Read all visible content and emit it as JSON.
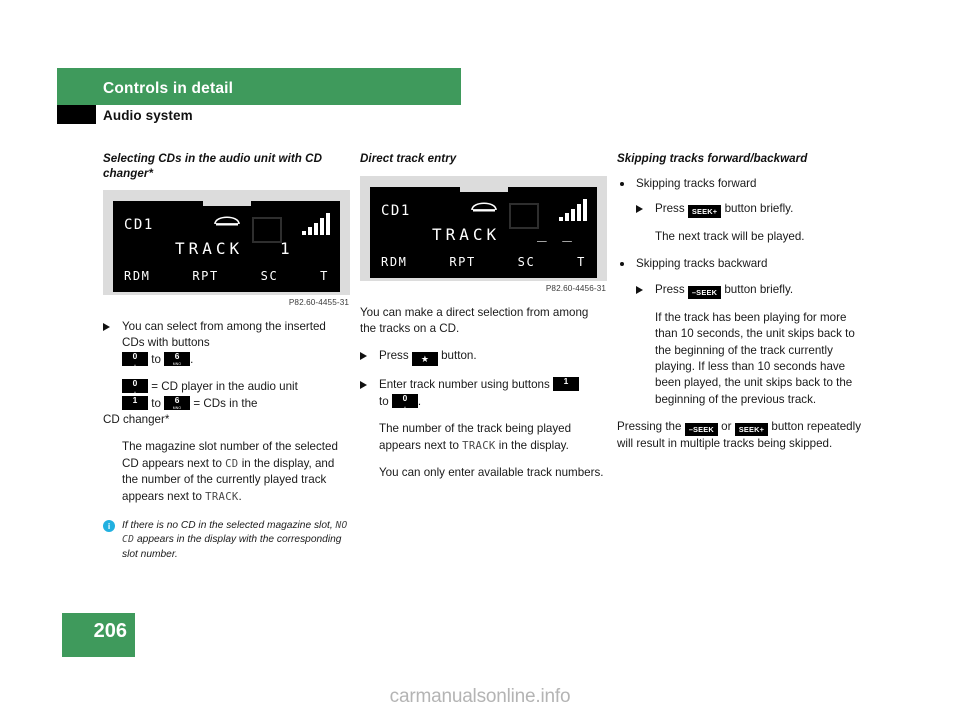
{
  "header": {
    "chapter_title": "Controls in detail",
    "section_title": "Audio system"
  },
  "footer": {
    "page_number": "206",
    "watermark": "carmanualsonline.info"
  },
  "colors": {
    "green": "#3f9a5c",
    "info_blue": "#21b0e0",
    "keycap_black": "#000000",
    "figure_bg": "#dcdcdc"
  },
  "column1": {
    "title": "Selecting CDs in the audio unit with CD changer*",
    "figure": {
      "caption": "P82.60-4455-31",
      "display": {
        "cd_label": "CD1",
        "track_label": "TRACK",
        "track_value": "1",
        "status_rdm": "RDM",
        "status_rpt": "RPT",
        "status_sc": "SC",
        "status_t": "T",
        "phone_icon": "handset-icon",
        "signal_icon": "signal-bars-icon"
      }
    },
    "step1_lead": "You can select from among the inserted CDs with buttons",
    "step1_to": "to",
    "step1_period": ".",
    "legend_line1": "= CD player in the audio unit",
    "legend_to": "to",
    "legend_line2": "= CDs in the",
    "legend_line2b": "CD changer*",
    "para1_a": "The magazine slot number of the selected CD appears next to ",
    "para1_mono1": "CD",
    "para1_b": " in the display, and the number of the currently played track appears next to ",
    "para1_mono2": "TRACK",
    "para1_c": ".",
    "note_a": "If there is no CD in the selected magazine slot, ",
    "note_mono": "NO  CD",
    "note_b": " appears in the display with the corresponding slot number.",
    "keys": {
      "zero": {
        "number": "0",
        "sub": "␣"
      },
      "six": {
        "number": "6",
        "sub": "MNO"
      },
      "one": {
        "number": "1",
        "sub": ""
      }
    }
  },
  "column2": {
    "title": "Direct track entry",
    "figure": {
      "caption": "P82.60-4456-31",
      "display": {
        "cd_label": "CD1",
        "track_label": "TRACK",
        "track_value": "_ _",
        "status_rdm": "RDM",
        "status_rpt": "RPT",
        "status_sc": "SC",
        "status_t": "T",
        "phone_icon": "handset-icon",
        "signal_icon": "signal-bars-icon"
      }
    },
    "para_intro": "You can make a direct selection from among the tracks on a CD.",
    "step1_a": "Press",
    "step1_b": "button.",
    "step2_a": "Enter track number using buttons",
    "step2_to": "to",
    "step2_end": ".",
    "para_a": "The number of the track being played appears next to ",
    "para_mono": "TRACK",
    "para_b": " in the display.",
    "para_last": "You can only enter available track numbers.",
    "keys": {
      "star": "★",
      "one": {
        "number": "1",
        "sub": ""
      },
      "zero": {
        "number": "0",
        "sub": "␣"
      }
    }
  },
  "column3": {
    "title": "Skipping tracks forward/backward",
    "bullet1": "Skipping tracks forward",
    "step1_a": "Press",
    "step1_key": "SEEK+",
    "step1_b": "button briefly.",
    "step1_note": "The next track will be played.",
    "bullet2": "Skipping tracks backward",
    "step2_a": "Press",
    "step2_key": "–SEEK",
    "step2_b": "button briefly.",
    "step2_note": "If the track has been playing for more than 10 seconds, the unit skips back to the beginning of the track currently playing. If less than 10 seconds have been played, the unit skips back to the beginning of the previous track.",
    "closing_a": "Pressing the",
    "closing_key1": "–SEEK",
    "closing_or": "or",
    "closing_key2": "SEEK+",
    "closing_b": "button repeatedly will result in multiple tracks being skipped."
  }
}
